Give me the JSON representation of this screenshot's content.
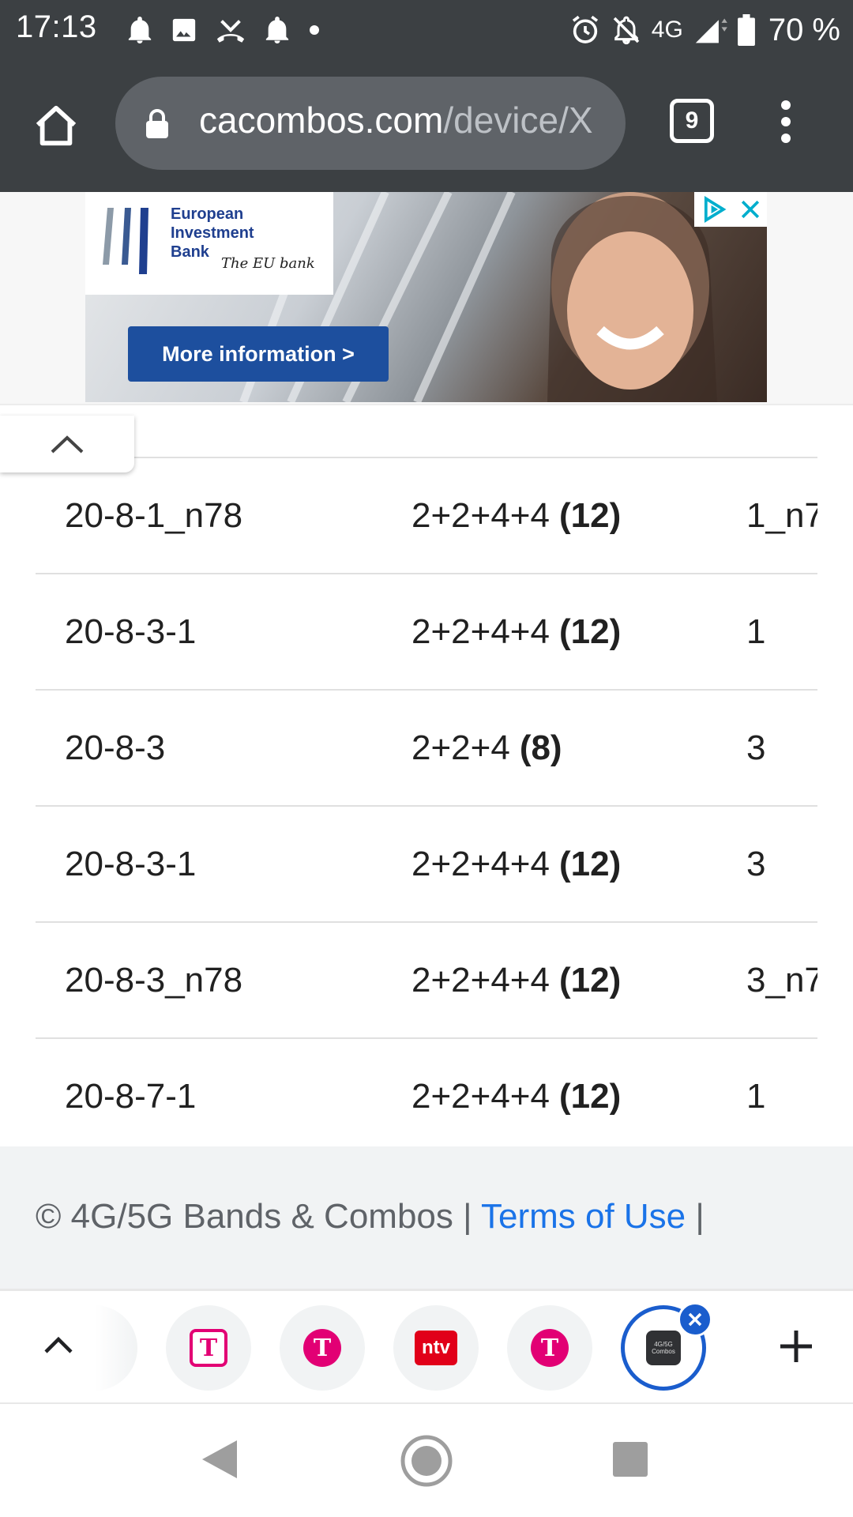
{
  "status_bar": {
    "time": "17:13",
    "network": "4G",
    "battery": "70 %",
    "icons": [
      "notification-bell-icon",
      "image-icon",
      "missed-call-icon",
      "notification-bell-icon",
      "dot-icon",
      "alarm-icon",
      "mute-icon",
      "signal-icon",
      "battery-icon"
    ]
  },
  "toolbar": {
    "url_host": "cacombos.com",
    "url_path": "/device/X",
    "tab_count": "9"
  },
  "ad": {
    "org_line1": "European",
    "org_line2": "Investment",
    "org_line3": "Bank",
    "tagline": "The EU bank",
    "cta": "More information >"
  },
  "table": {
    "rows": [
      {
        "combo": "20-8-1_n78",
        "mimo": "2+2+4+4",
        "total": "(12)",
        "next": "1_n7"
      },
      {
        "combo": "20-8-3-1",
        "mimo": "2+2+4+4",
        "total": "(12)",
        "next": "1"
      },
      {
        "combo": "20-8-3",
        "mimo": "2+2+4",
        "total": "(8)",
        "next": "3"
      },
      {
        "combo": "20-8-3-1",
        "mimo": "2+2+4+4",
        "total": "(12)",
        "next": "3"
      },
      {
        "combo": "20-8-3_n78",
        "mimo": "2+2+4+4",
        "total": "(12)",
        "next": "3_n7"
      },
      {
        "combo": "20-8-7-1",
        "mimo": "2+2+4+4",
        "total": "(12)",
        "next": "1"
      }
    ]
  },
  "footer": {
    "copyright": "© 4G/5G Bands & Combos |",
    "terms": "Terms of Use",
    "sep": "|"
  },
  "tab_strip": {
    "ntv_label": "ntv",
    "combos_label": "4G/5G Combos",
    "telekom_glyph": "T"
  },
  "colors": {
    "chrome_dark": "#3c4043",
    "link_blue": "#1a73e8",
    "telekom_magenta": "#e20074",
    "ntv_red": "#e10019",
    "active_tab_blue": "#1a5dcd"
  }
}
